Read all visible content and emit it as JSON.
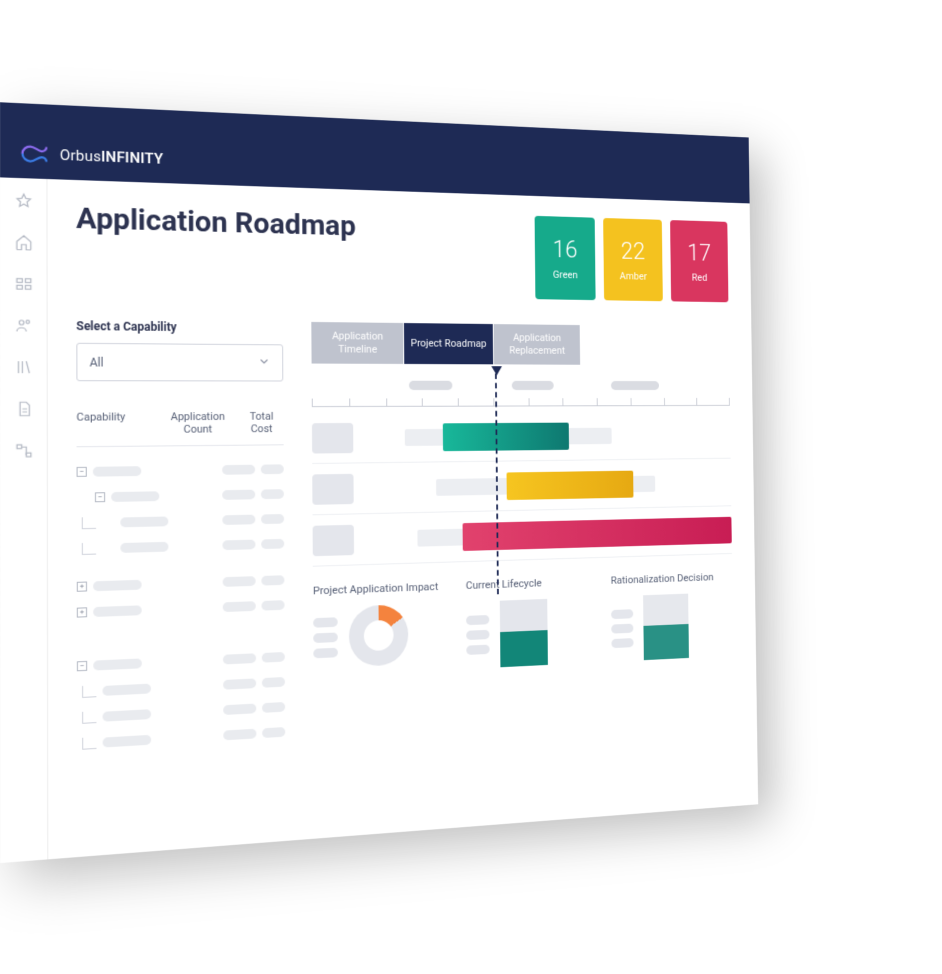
{
  "brand": {
    "line1": "Orbus",
    "line2": "INFINITY"
  },
  "page": {
    "title": "Application Roadmap"
  },
  "kpis": {
    "green": {
      "value": "16",
      "label": "Green",
      "color": "#16aa8b"
    },
    "amber": {
      "value": "22",
      "label": "Amber",
      "color": "#f4c21f"
    },
    "red": {
      "value": "17",
      "label": "Red",
      "color": "#d9365f"
    }
  },
  "filter": {
    "label": "Select a Capability",
    "selected": "All"
  },
  "table": {
    "headers": {
      "c1": "Capability",
      "c2": "Application Count",
      "c3": "Total Cost"
    }
  },
  "tabs": {
    "t1": "Application Timeline",
    "t2": "Project Roadmap",
    "t3": "Application Replacement"
  },
  "panels": {
    "p1": "Project Application Impact",
    "p2": "Current Lifecycle",
    "p3": "Rationalization Decision"
  },
  "chart_data": {
    "type": "bar",
    "orientation": "horizontal-gantt",
    "timeline_range": [
      0,
      12
    ],
    "today_marker": 5.1,
    "series": [
      {
        "name": "Green",
        "shadow_start": 1.2,
        "shadow_end": 8.0,
        "start": 2.4,
        "end": 6.4,
        "color": "#16aa8b"
      },
      {
        "name": "Amber",
        "shadow_start": 2.2,
        "shadow_end": 9.4,
        "start": 4.4,
        "end": 8.6,
        "color": "#f4c21f"
      },
      {
        "name": "Red",
        "shadow_start": 1.6,
        "shadow_end": 12.0,
        "start": 3.0,
        "end": 12.0,
        "color": "#d9365f"
      }
    ],
    "timeline_segments": [
      {
        "start": 3.2,
        "end": 4.6
      },
      {
        "start": 6.0,
        "end": 7.4
      },
      {
        "start": 9.0,
        "end": 10.6
      }
    ]
  }
}
